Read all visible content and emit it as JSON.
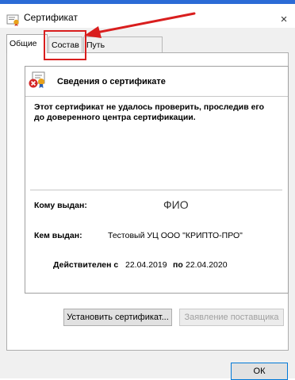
{
  "window": {
    "title": "Сертификат",
    "close_glyph": "×"
  },
  "tabs": [
    {
      "label": "Общие",
      "active": true
    },
    {
      "label": "Состав",
      "active": false
    },
    {
      "label": "Путь сертификации",
      "active": false
    }
  ],
  "info": {
    "title": "Сведения о сертификате",
    "warning": "Этот сертификат не удалось проверить, проследив его до доверенного центра сертификации.",
    "issued_to_label": "Кому выдан:",
    "issued_to_value": "ФИО",
    "issued_by_label": "Кем выдан:",
    "issued_by_value": "Тестовый УЦ ООО \"КРИПТО-ПРО\"",
    "valid_from_label": "Действителен с",
    "valid_from": "22.04.2019",
    "valid_to_label": "по",
    "valid_to": "22.04.2020"
  },
  "buttons": {
    "install": "Установить сертификат...",
    "issuer_statement": "Заявление поставщика",
    "ok": "ОК"
  },
  "annotation": {
    "color": "#d91e1e"
  }
}
